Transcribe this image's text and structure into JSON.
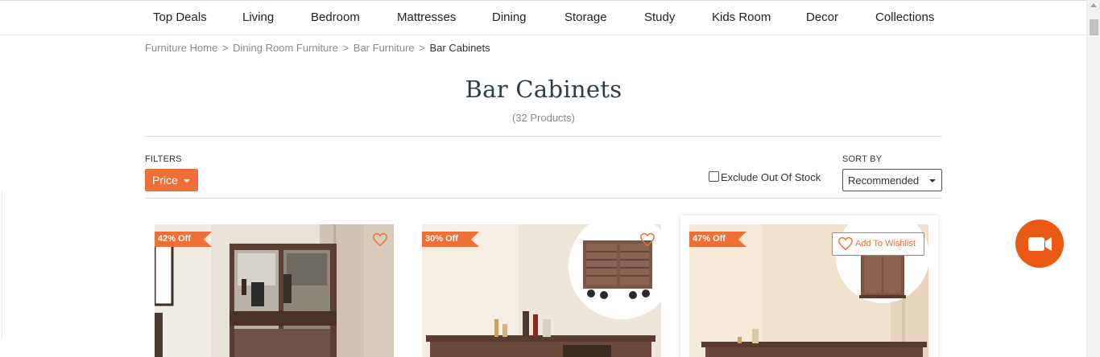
{
  "nav": {
    "items": [
      "Top Deals",
      "Living",
      "Bedroom",
      "Mattresses",
      "Dining",
      "Storage",
      "Study",
      "Kids Room",
      "Decor",
      "Collections"
    ]
  },
  "breadcrumb": {
    "items": [
      "Furniture Home",
      "Dining Room Furniture",
      "Bar Furniture"
    ],
    "separator": ">",
    "current": "Bar Cabinets"
  },
  "page": {
    "title": "Bar Cabinets",
    "count": "(32 Products)"
  },
  "filters": {
    "label": "FILTERS",
    "price_label": "Price"
  },
  "exclude_label": "Exclude Out Of Stock",
  "exclude_checked": false,
  "sort": {
    "label": "SORT BY",
    "selected": "Recommended"
  },
  "products": [
    {
      "discount": "42% Off",
      "wishlist_icon": "heart-outline-icon"
    },
    {
      "discount": "30% Off",
      "wishlist_icon": "heart-outline-icon"
    },
    {
      "discount": "47% Off",
      "wishlist_label": "Add To Wishlist",
      "wishlist_icon": "heart-outline-icon"
    }
  ],
  "colors": {
    "accent": "#ef6f36",
    "title": "#2f3b4a",
    "video_button": "#ea5a12"
  },
  "icons": {
    "video": "video-camera-icon",
    "caret": "caret-down-icon"
  }
}
